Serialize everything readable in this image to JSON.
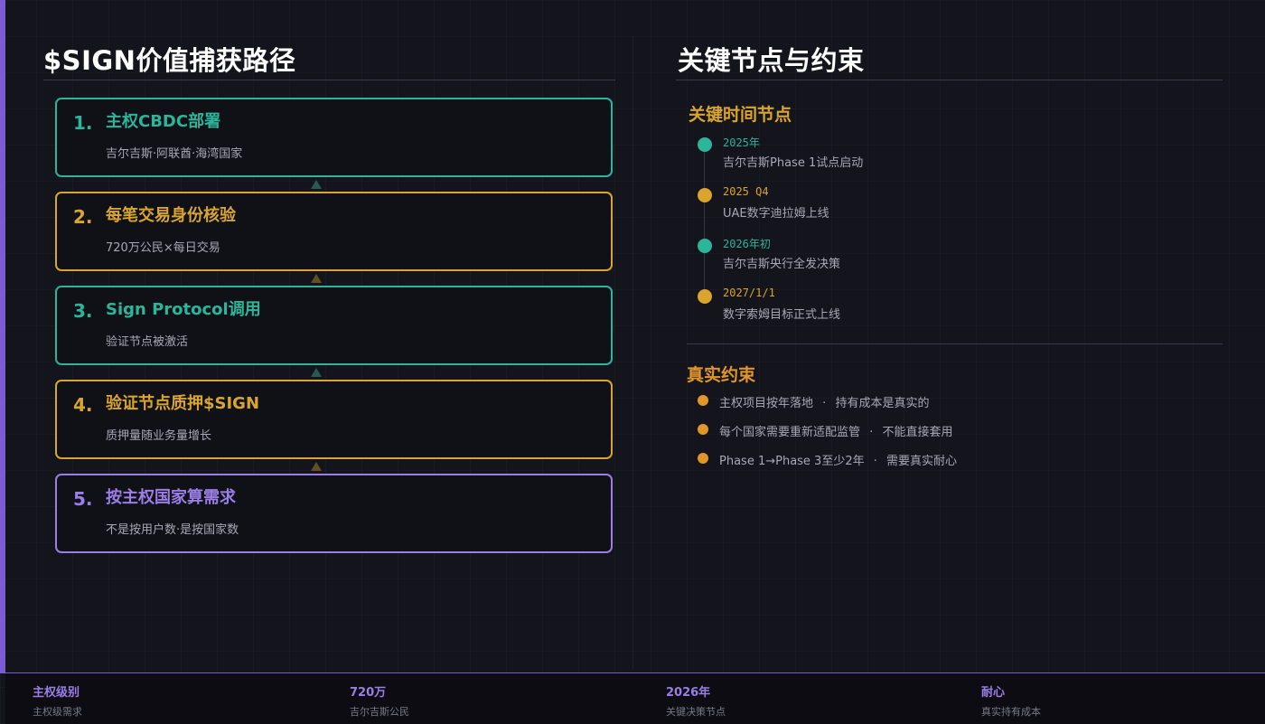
{
  "left": {
    "title": "$SIGN价值捕获路径",
    "steps": [
      {
        "num": "1.",
        "title": "主权CBDC部署",
        "desc": "吉尔吉斯·阿联酋·海湾国家",
        "color": "#2bb59a"
      },
      {
        "num": "2.",
        "title": "每笔交易身份核验",
        "desc": "720万公民×每日交易",
        "color": "#d9a52e"
      },
      {
        "num": "3.",
        "title": "Sign Protocol调用",
        "desc": "验证节点被激活",
        "color": "#2bb59a"
      },
      {
        "num": "4.",
        "title": "验证节点质押$SIGN",
        "desc": "质押量随业务量增长",
        "color": "#d9a52e"
      },
      {
        "num": "5.",
        "title": "按主权国家算需求",
        "desc": "不是按用户数·是按国家数",
        "color": "#9b7ee6"
      }
    ]
  },
  "right": {
    "title": "关键节点与约束",
    "timeline_title": "关键时间节点",
    "timeline": [
      {
        "date": "2025年",
        "text": "吉尔吉斯Phase 1试点启动",
        "color": "#2bb59a"
      },
      {
        "date": "2025 Q4",
        "text": "UAE数字迪拉姆上线",
        "color": "#d9a52e"
      },
      {
        "date": "2026年初",
        "text": "吉尔吉斯央行全发决策",
        "color": "#2bb59a"
      },
      {
        "date": "2027/1/1",
        "text": "数字索姆目标正式上线",
        "color": "#d9a52e"
      }
    ],
    "constraints_title": "真实约束",
    "constraints": [
      {
        "main": "主权项目按年落地",
        "note": "持有成本是真实的"
      },
      {
        "main": "每个国家需要重新适配监管",
        "note": "不能直接套用"
      },
      {
        "main": "Phase 1→Phase 3至少2年",
        "note": "需要真实耐心"
      }
    ]
  },
  "footer": [
    {
      "value": "主权级别",
      "label": "主权级需求"
    },
    {
      "value": "720万",
      "label": "吉尔吉斯公民"
    },
    {
      "value": "2026年",
      "label": "关键决策节点"
    },
    {
      "value": "耐心",
      "label": "真实持有成本"
    }
  ],
  "colors": {
    "teal": "#2bb59a",
    "gold": "#d9a52e",
    "purple": "#9b7ee6",
    "orange": "#e0962a"
  }
}
